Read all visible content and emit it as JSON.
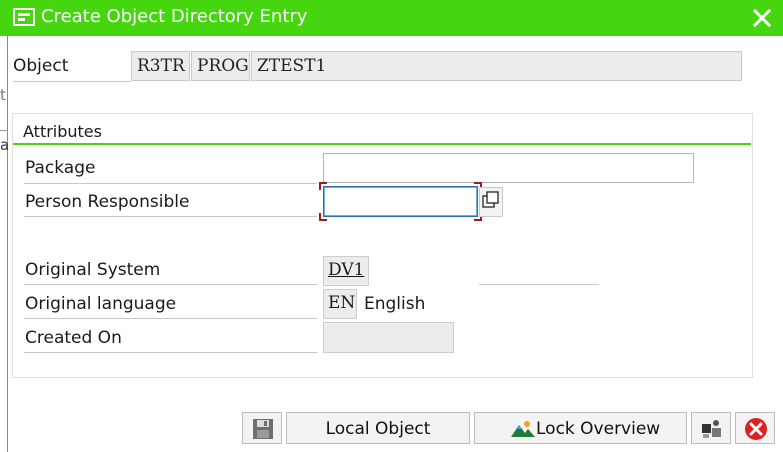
{
  "window": {
    "title": "Create Object Directory Entry"
  },
  "background": {
    "fragment_1": "t",
    "fragment_2": "a"
  },
  "object": {
    "label": "Object",
    "pgmid": "R3TR",
    "type": "PROG",
    "name": "ZTEST1"
  },
  "attributes": {
    "title": "Attributes",
    "package": {
      "label": "Package",
      "value": ""
    },
    "person_responsible": {
      "label": "Person Responsible",
      "value": ""
    },
    "original_system": {
      "label": "Original System",
      "value": "DV1"
    },
    "original_language": {
      "label": "Original language",
      "code": "EN",
      "text": "English"
    },
    "created_on": {
      "label": "Created On",
      "value": ""
    }
  },
  "buttons": {
    "local_object": "Local Object",
    "lock_overview": "Lock Overview"
  },
  "icons": {
    "title": "dialog-icon",
    "close": "close-icon",
    "save": "save-icon",
    "lock": "mountain-icon",
    "tool": "puzzle-icon",
    "cancel": "cancel-icon"
  },
  "colors": {
    "title_bar": "#45d60f",
    "group_line": "#45d60f",
    "focus_border": "#2a6fb5",
    "cancel_red": "#e02020"
  }
}
